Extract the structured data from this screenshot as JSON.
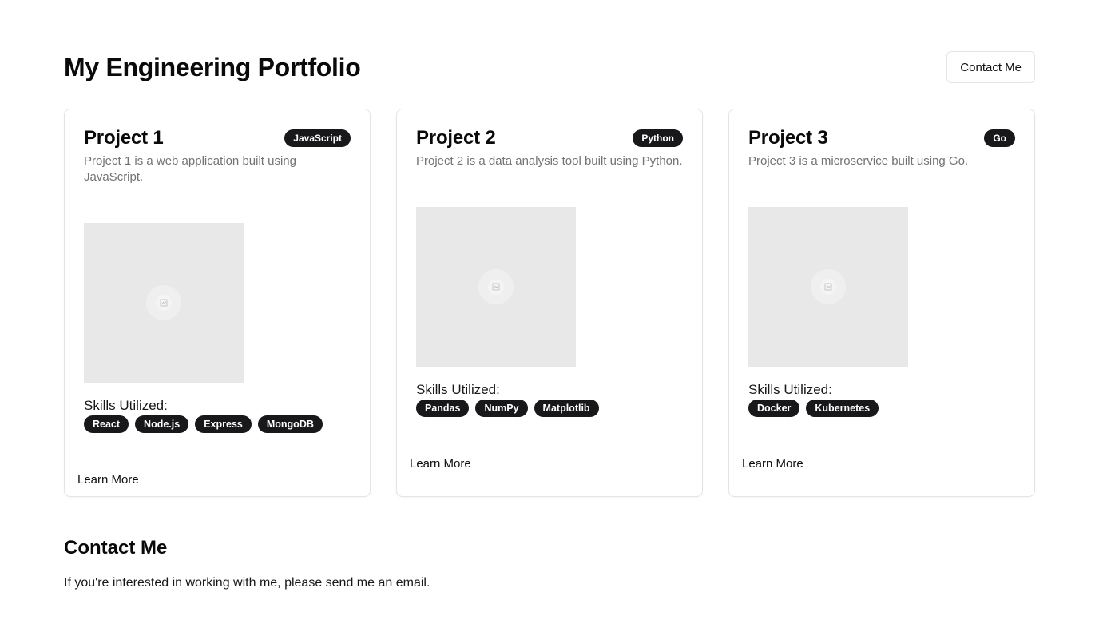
{
  "header": {
    "title": "My Engineering Portfolio",
    "contact_button": "Contact Me"
  },
  "projects": [
    {
      "title": "Project 1",
      "language": "JavaScript",
      "description": "Project 1 is a web application built using JavaScript.",
      "image_icon": "image-placeholder-icon",
      "skills_label": "Skills Utilized:",
      "skills": [
        "React",
        "Node.js",
        "Express",
        "MongoDB"
      ],
      "learn_more": "Learn More"
    },
    {
      "title": "Project 2",
      "language": "Python",
      "description": "Project 2 is a data analysis tool built using Python.",
      "image_icon": "image-placeholder-icon",
      "skills_label": "Skills Utilized:",
      "skills": [
        "Pandas",
        "NumPy",
        "Matplotlib"
      ],
      "learn_more": "Learn More"
    },
    {
      "title": "Project 3",
      "language": "Go",
      "description": "Project 3 is a microservice built using Go.",
      "image_icon": "image-placeholder-icon",
      "skills_label": "Skills Utilized:",
      "skills": [
        "Docker",
        "Kubernetes"
      ],
      "learn_more": "Learn More"
    }
  ],
  "contact": {
    "title": "Contact Me",
    "text": "If you're interested in working with me, please send me an email."
  },
  "colors": {
    "badge_bg": "#18181b",
    "border": "#e4e4e7",
    "muted_text": "#737373",
    "placeholder_bg": "#e8e8e8"
  }
}
